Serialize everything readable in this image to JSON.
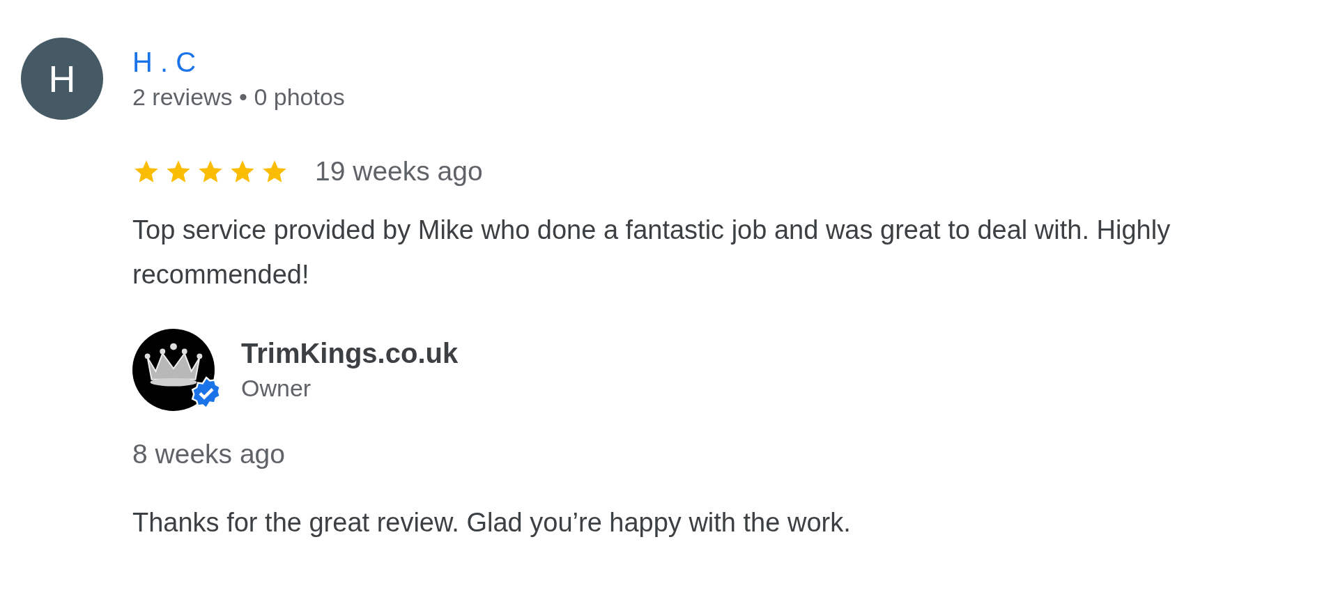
{
  "review": {
    "avatar_letter": "H",
    "reviewer": "H . C",
    "meta": "2 reviews • 0 photos",
    "stars": 5,
    "time": "19 weeks ago",
    "text": "Top service provided by Mike who done a fantastic job and was great to deal with. Highly recommended!"
  },
  "reply": {
    "owner_name": "TrimKings.co.uk",
    "verified": true,
    "role": "Owner",
    "time": "8 weeks ago",
    "text": "Thanks for the great review. Glad you’re happy with the work."
  }
}
